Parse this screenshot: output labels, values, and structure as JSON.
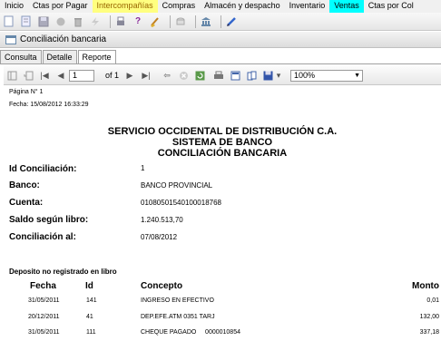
{
  "menu": {
    "items": [
      {
        "label": "Inicio",
        "hl": ""
      },
      {
        "label": "Ctas por Pagar",
        "hl": ""
      },
      {
        "label": "Intercompañías",
        "hl": "hl-yellow"
      },
      {
        "label": "Compras",
        "hl": ""
      },
      {
        "label": "Almacén y despacho",
        "hl": ""
      },
      {
        "label": "Inventario",
        "hl": ""
      },
      {
        "label": "Ventas",
        "hl": "hl-cyan"
      },
      {
        "label": "Ctas por Col",
        "hl": ""
      }
    ]
  },
  "window": {
    "title": "Conciliación bancaria"
  },
  "tabs": [
    "Consulta",
    "Detalle",
    "Reporte"
  ],
  "viewer": {
    "page_value": "1",
    "page_of": "of 1",
    "zoom": "100%"
  },
  "report": {
    "page_label": "Página N° 1",
    "date_label": "Fecha: 15/08/2012 16:33:29",
    "company": "SERVICIO OCCIDENTAL DE DISTRIBUCIÓN C.A.",
    "system": "SISTEMA DE BANCO",
    "report_name": "CONCILIACIÓN BANCARIA",
    "fields": {
      "id_label": "Id Conciliación:",
      "id_value": "1",
      "bank_label": "Banco:",
      "bank_value": "BANCO PROVINCIAL",
      "account_label": "Cuenta:",
      "account_value": "01080501540100018768",
      "balance_label": "Saldo según libro:",
      "balance_value": "1.240.513,70",
      "date_label": "Conciliación al:",
      "date_value": "07/08/2012"
    },
    "section_title": "Deposito no registrado en libro",
    "columns": {
      "fecha": "Fecha",
      "id": "Id",
      "concepto": "Concepto",
      "monto": "Monto"
    },
    "rows": [
      {
        "fecha": "31/05/2011",
        "id": "141",
        "concepto": "INGRESO EN EFECTIVO",
        "monto": "0,01"
      },
      {
        "fecha": "20/12/2011",
        "id": "41",
        "concepto": "DEP.EFE.ATM 0351 TARJ",
        "monto": "132,00"
      },
      {
        "fecha": "31/05/2011",
        "id": "111",
        "concepto": "CHEQUE PAGADO     0000010854",
        "monto": "337,18"
      }
    ]
  }
}
